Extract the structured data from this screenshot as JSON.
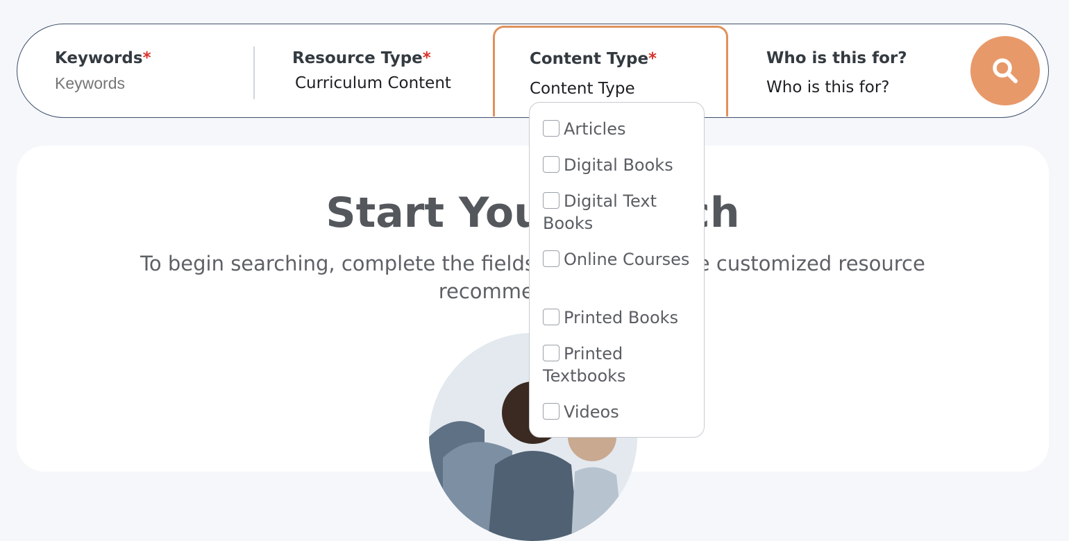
{
  "search_bar": {
    "keywords": {
      "label": "Keywords",
      "required_mark": "*",
      "placeholder": "Keywords"
    },
    "resource_type": {
      "label": "Resource Type",
      "required_mark": "*",
      "value": "Curriculum Content"
    },
    "content_type": {
      "label": "Content Type",
      "required_mark": "*",
      "value": "Content Type"
    },
    "who_for": {
      "label": "Who is this for?",
      "value": "Who is this for?"
    },
    "search_icon": "search-icon"
  },
  "main": {
    "title": "Start Your Search",
    "subtitle": "To begin searching, complete the fields above to receive customized resource recommendations."
  },
  "content_type_options": [
    {
      "label": "Articles",
      "checked": false
    },
    {
      "label": "Digital Books",
      "checked": false
    },
    {
      "label": "Digital Text Books",
      "checked": false
    },
    {
      "label": "Online Courses",
      "checked": false
    },
    {
      "label": "Printed Books",
      "checked": false
    },
    {
      "label": "Printed Textbooks",
      "checked": false
    },
    {
      "label": "Videos",
      "checked": false
    }
  ],
  "colors": {
    "accent": "#e8996a",
    "active_border": "#e0915c",
    "bar_border": "#3c4e6b",
    "required": "#d8332b"
  }
}
